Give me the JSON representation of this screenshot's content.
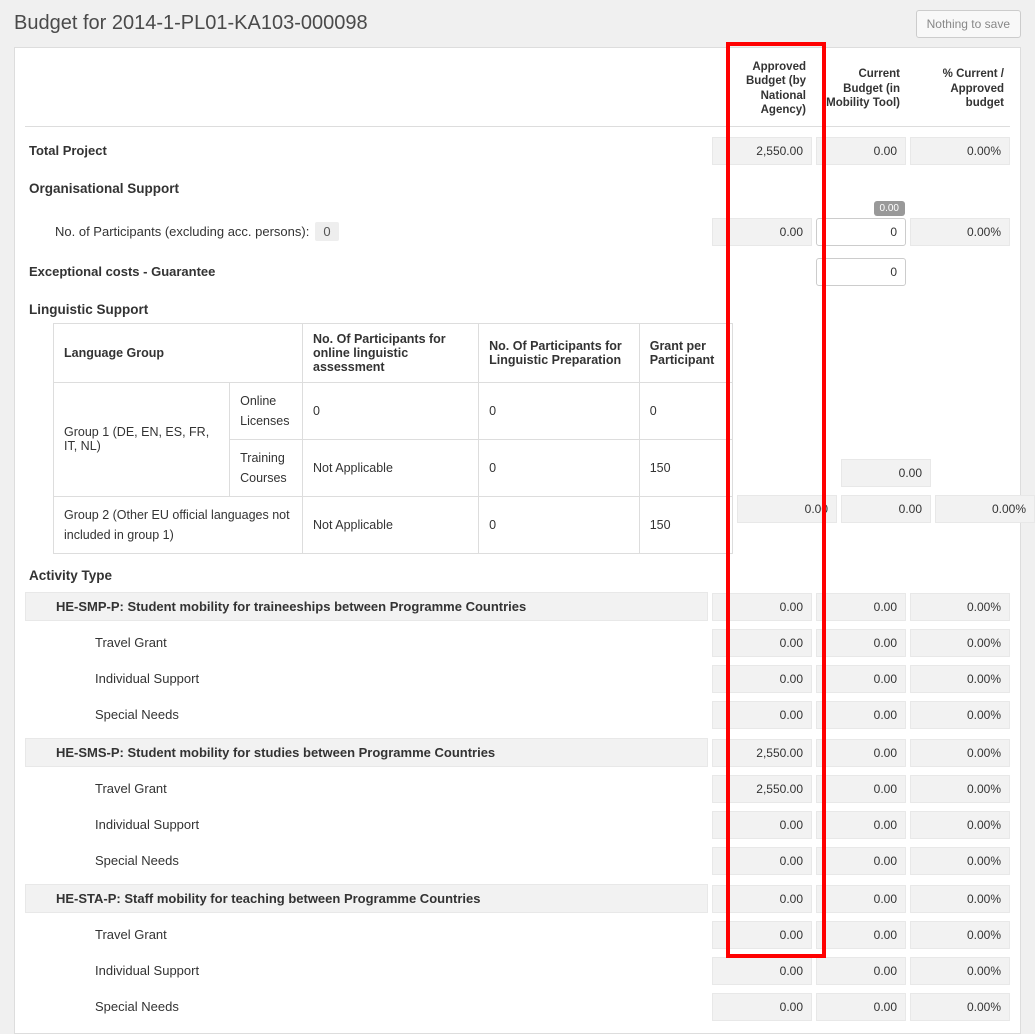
{
  "header": {
    "title": "Budget for 2014-1-PL01-KA103-000098",
    "save_btn": "Nothing to save"
  },
  "columns": {
    "approved": "Approved Budget (by National Agency)",
    "current": "Current Budget (in Mobility Tool)",
    "percent": "% Current / Approved budget"
  },
  "sections": {
    "total_project": "Total Project",
    "org_support": "Organisational Support",
    "participants_label": "No. of Participants (excluding acc. persons):",
    "participants_value": "0",
    "exceptional": "Exceptional costs - Guarantee",
    "linguistic": "Linguistic Support",
    "activity_type": "Activity Type"
  },
  "total_project_row": {
    "approved": "2,550.00",
    "current": "0.00",
    "percent": "0.00%"
  },
  "org_support_row": {
    "pill": "0.00",
    "approved": "0.00",
    "current_input": "0",
    "percent": "0.00%"
  },
  "exceptional_row": {
    "current_input": "0"
  },
  "linguistic_table": {
    "headers": {
      "group": "Language Group",
      "type_blank": "",
      "online_assess": "No. Of Participants for online linguistic assessment",
      "ling_prep": "No. Of Participants for Linguistic Preparation",
      "grant": "Grant per Participant"
    },
    "g1_label": "Group 1 (DE, EN, ES, FR, IT, NL)",
    "g1_online": {
      "type": "Online Licenses",
      "a": "0",
      "b": "0",
      "c": "0"
    },
    "g1_training": {
      "type": "Training Courses",
      "a": "Not Applicable",
      "b": "0",
      "c": "150"
    },
    "g2_label": "Group 2 (Other EU official languages not included in group 1)",
    "g2_row": {
      "a": "Not Applicable",
      "b": "0",
      "c": "150"
    }
  },
  "ling_side": {
    "row1_current": "0.00",
    "row2": {
      "approved": "0.00",
      "current": "0.00",
      "percent": "0.00%"
    }
  },
  "activities": [
    {
      "label": "HE-SMP-P: Student mobility for traineeships between Programme Countries",
      "approved": "0.00",
      "current": "0.00",
      "percent": "0.00%",
      "subs": [
        {
          "label": "Travel Grant",
          "approved": "0.00",
          "current": "0.00",
          "percent": "0.00%"
        },
        {
          "label": "Individual Support",
          "approved": "0.00",
          "current": "0.00",
          "percent": "0.00%"
        },
        {
          "label": "Special Needs",
          "approved": "0.00",
          "current": "0.00",
          "percent": "0.00%"
        }
      ]
    },
    {
      "label": "HE-SMS-P: Student mobility for studies between Programme Countries",
      "approved": "2,550.00",
      "current": "0.00",
      "percent": "0.00%",
      "subs": [
        {
          "label": "Travel Grant",
          "approved": "2,550.00",
          "current": "0.00",
          "percent": "0.00%"
        },
        {
          "label": "Individual Support",
          "approved": "0.00",
          "current": "0.00",
          "percent": "0.00%"
        },
        {
          "label": "Special Needs",
          "approved": "0.00",
          "current": "0.00",
          "percent": "0.00%"
        }
      ]
    },
    {
      "label": "HE-STA-P: Staff mobility for teaching between Programme Countries",
      "approved": "0.00",
      "current": "0.00",
      "percent": "0.00%",
      "subs": [
        {
          "label": "Travel Grant",
          "approved": "0.00",
          "current": "0.00",
          "percent": "0.00%"
        },
        {
          "label": "Individual Support",
          "approved": "0.00",
          "current": "0.00",
          "percent": "0.00%"
        },
        {
          "label": "Special Needs",
          "approved": "0.00",
          "current": "0.00",
          "percent": "0.00%"
        }
      ]
    }
  ]
}
